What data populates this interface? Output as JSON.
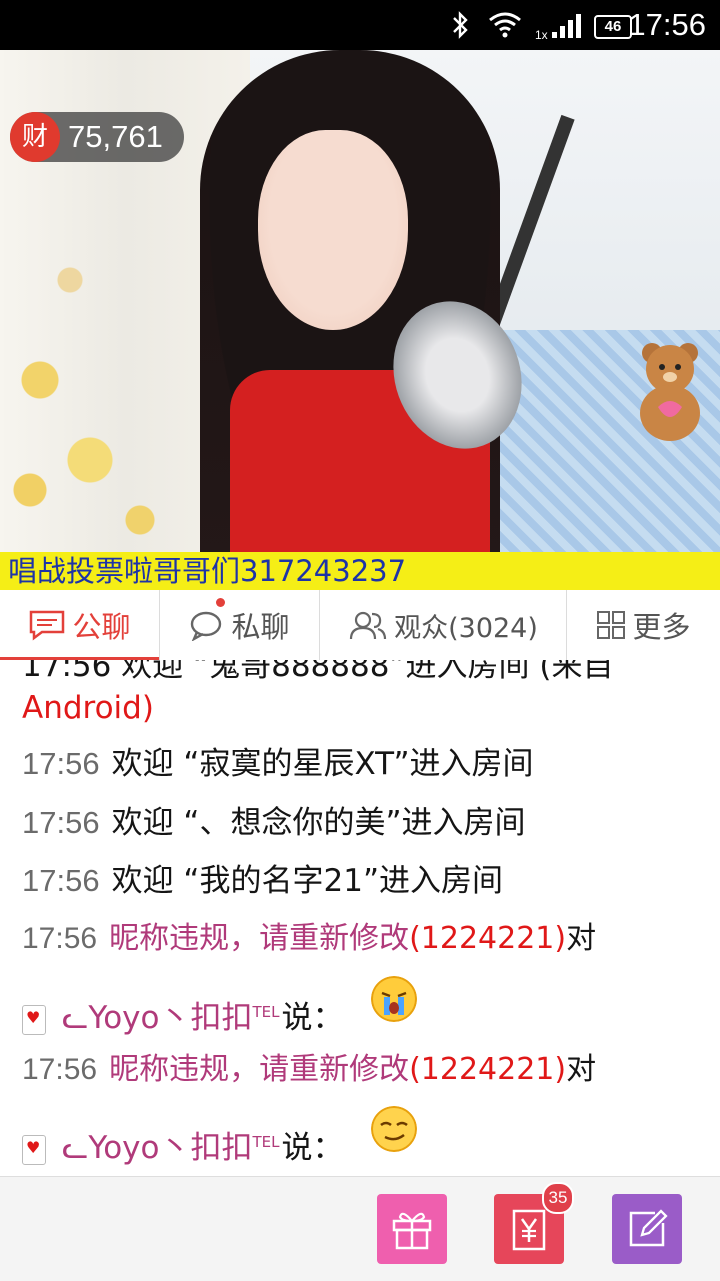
{
  "status_bar": {
    "time": "17:56",
    "network_badge": "46",
    "signal_label": "1x",
    "icons": [
      "bluetooth-icon",
      "wifi-icon",
      "signal-icon"
    ]
  },
  "video": {
    "wealth_icon_char": "财",
    "wealth_count": "75,761",
    "ticker_text": "唱战投票啦哥哥们317243237"
  },
  "tabs": [
    {
      "label": "公聊",
      "icon": "chat-icon",
      "active": true
    },
    {
      "label": "私聊",
      "icon": "private-chat-icon",
      "active": false
    },
    {
      "label": "观众(3024)",
      "icon": "audience-icon",
      "active": false
    },
    {
      "label": "更多",
      "icon": "grid-icon",
      "active": false
    }
  ],
  "chat": {
    "partial_line": "17:56  欢迎 “鬼哥888888”进入房间 (来自",
    "partial_tail": "Android)",
    "lines": [
      {
        "time": "17:56",
        "text": "欢迎 “寂寞的星辰XT”进入房间"
      },
      {
        "time": "17:56",
        "text": "欢迎 “、想念你的美”进入房间"
      },
      {
        "time": "17:56",
        "text": "欢迎 “我的名字21”进入房间"
      }
    ],
    "system_1": {
      "time": "17:56",
      "notice": "昵称违规，请重新修改",
      "id": "(1224221)",
      "suffix": "对",
      "user": "ᓚYoyo丶扣扣",
      "user_sup": "TEL",
      "say": "说：",
      "emoji": "crying-face-icon"
    },
    "system_2": {
      "time": "17:56",
      "notice": "昵称违规，请重新修改",
      "id": "(1224221)",
      "suffix": "对",
      "user": "ᓚYoyo丶扣扣",
      "user_sup": "TEL",
      "say": "说：",
      "emoji": "smug-face-icon"
    }
  },
  "bottom_bar": {
    "gift_color": "#ef5fae",
    "money_color": "#e6465a",
    "money_badge": "35",
    "edit_color": "#9a5cc8"
  },
  "colors": {
    "accent": "#e3403a",
    "ticker_bg": "#f5ee16",
    "ticker_text": "#1d33a8",
    "system_purple": "#b03a7a",
    "id_red": "#e01818"
  }
}
